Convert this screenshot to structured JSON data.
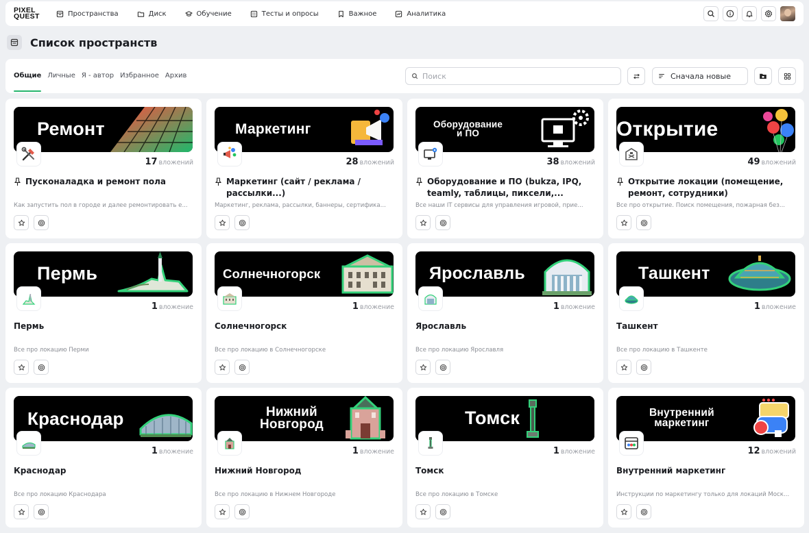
{
  "brand": {
    "logo_line1": "PIXEL",
    "logo_line2": "QUEST"
  },
  "nav": [
    {
      "label": "Пространства",
      "icon": "spaces-icon"
    },
    {
      "label": "Диск",
      "icon": "folder-icon"
    },
    {
      "label": "Обучение",
      "icon": "graduation-cap-icon"
    },
    {
      "label": "Тесты и опросы",
      "icon": "quiz-icon"
    },
    {
      "label": "Важное",
      "icon": "bookmark-icon"
    },
    {
      "label": "Аналитика",
      "icon": "analytics-icon"
    }
  ],
  "top_actions": [
    "search-icon",
    "info-icon",
    "bell-icon",
    "gear-icon"
  ],
  "page": {
    "title": "Список пространств"
  },
  "tabs": [
    {
      "label": "Общие",
      "active": true
    },
    {
      "label": "Личные",
      "active": false
    },
    {
      "label": "Я - автор",
      "active": false
    },
    {
      "label": "Избранное",
      "active": false
    },
    {
      "label": "Архив",
      "active": false
    }
  ],
  "search": {
    "placeholder": "Поиск",
    "value": ""
  },
  "sort": {
    "selected": "Сначала новые"
  },
  "colors": {
    "accent": "#27b56e",
    "banner_bg": "#000000"
  },
  "cards": [
    {
      "banner": "Ремонт",
      "icon": "tools-icon",
      "count": "17",
      "unit": "вложений",
      "pinned": true,
      "title": "Пусконаладка и ремонт пола",
      "desc": "Как запустить пол в городе и далее ремонтировать е..."
    },
    {
      "banner": "Маркетинг",
      "icon": "megaphone-icon",
      "count": "28",
      "unit": "вложений",
      "pinned": true,
      "title": "Маркетинг (сайт / реклама / рассылки...)",
      "desc": "Маркетинг, реклама, рассылки, баннеры, сертифика..."
    },
    {
      "banner": "Оборудование\nи ПО",
      "icon": "computer-gear-icon",
      "count": "38",
      "unit": "вложений",
      "pinned": true,
      "title": "Оборудование и ПО (bukza, IPQ, teamly, таблицы, пиксели,...",
      "desc": "Все наши IT сервисы для управления игровой, прие..."
    },
    {
      "banner": "Открытие",
      "icon": "building-icon",
      "count": "49",
      "unit": "вложений",
      "pinned": true,
      "title": "Открытие локации (помещение, ремонт, сотрудники)",
      "desc": "Все про открытие. Поиск помещения, пожарная без..."
    },
    {
      "banner": "Пермь",
      "icon": "perm-landmark-icon",
      "count": "1",
      "unit": "вложение",
      "pinned": false,
      "title": "Пермь",
      "desc": "Все про локацию Перми"
    },
    {
      "banner": "Солнечногорск",
      "icon": "solnechnogorsk-landmark-icon",
      "count": "1",
      "unit": "вложение",
      "pinned": false,
      "title": "Солнечногорск",
      "desc": "Все про локацию в Солнечногорске"
    },
    {
      "banner": "Ярославль",
      "icon": "yaroslavl-landmark-icon",
      "count": "1",
      "unit": "вложение",
      "pinned": false,
      "title": "Ярославль",
      "desc": "Все про локацию Ярославля"
    },
    {
      "banner": "Ташкент",
      "icon": "tashkent-landmark-icon",
      "count": "1",
      "unit": "вложение",
      "pinned": false,
      "title": "Ташкент",
      "desc": "Все про локацию в Ташкенте"
    },
    {
      "banner": "Краснодар",
      "icon": "krasnodar-landmark-icon",
      "count": "1",
      "unit": "вложение",
      "pinned": false,
      "title": "Краснодар",
      "desc": "Все про локацию Краснодара"
    },
    {
      "banner": "Нижний\nНовгород",
      "icon": "nizhny-landmark-icon",
      "count": "1",
      "unit": "вложение",
      "pinned": false,
      "title": "Нижний Новгород",
      "desc": "Все про локацию в Нижнем Новгороде"
    },
    {
      "banner": "Томск",
      "icon": "tomsk-landmark-icon",
      "count": "1",
      "unit": "вложение",
      "pinned": false,
      "title": "Томск",
      "desc": "Все про локацию в Томске"
    },
    {
      "banner": "Внутренний\nмаркетинг",
      "icon": "internal-marketing-icon",
      "count": "12",
      "unit": "вложений",
      "pinned": false,
      "title": "Внутренний маркетинг",
      "desc": "Инструкции по маркетингу только для локаций Моск..."
    }
  ]
}
